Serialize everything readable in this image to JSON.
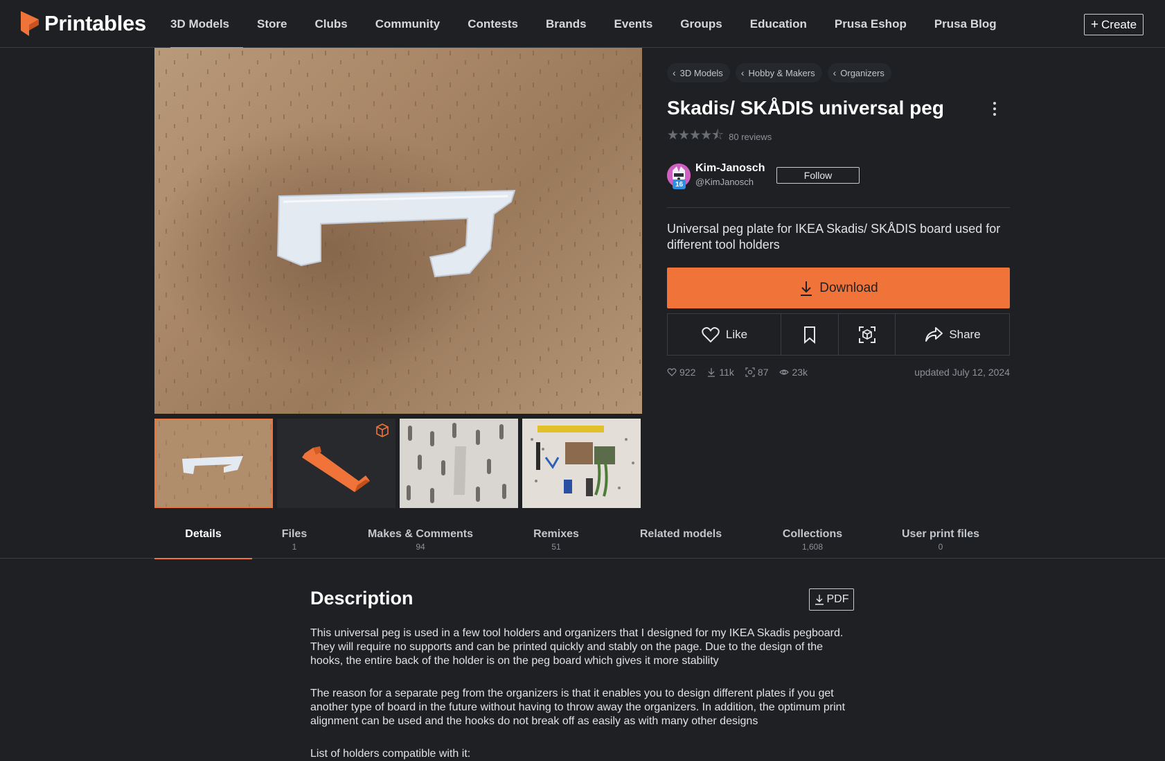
{
  "app": {
    "brand": "Printables",
    "accent": "#f0743a"
  },
  "nav": {
    "items": [
      "3D Models",
      "Store",
      "Clubs",
      "Community",
      "Contests",
      "Brands",
      "Events",
      "Groups",
      "Education",
      "Prusa Eshop",
      "Prusa Blog"
    ],
    "create_label": "Create"
  },
  "breadcrumbs": [
    "3D Models",
    "Hobby & Makers",
    "Organizers"
  ],
  "model": {
    "title": "Skadis/ SKÅDIS universal peg",
    "rating_stars": 4.5,
    "reviews": "80 reviews",
    "summary": "Universal peg plate for IKEA Skadis/ SKÅDIS board used for different tool holders"
  },
  "author": {
    "name": "Kim-Janosch",
    "handle": "@KimJanosch",
    "badge": "16",
    "follow_label": "Follow"
  },
  "actions": {
    "download": "Download",
    "like": "Like",
    "share": "Share",
    "icons": [
      "heart-icon",
      "bookmark-icon",
      "ar-view-icon",
      "share-icon"
    ]
  },
  "stats": {
    "likes": "922",
    "downloads": "11k",
    "makes": "87",
    "views": "23k",
    "updated": "updated July 12, 2024"
  },
  "tabs": [
    {
      "label": "Details",
      "count": ""
    },
    {
      "label": "Files",
      "count": "1"
    },
    {
      "label": "Makes & Comments",
      "count": "94"
    },
    {
      "label": "Remixes",
      "count": "51"
    },
    {
      "label": "Related models",
      "count": ""
    },
    {
      "label": "Collections",
      "count": "1,608"
    },
    {
      "label": "User print files",
      "count": "0"
    }
  ],
  "description": {
    "title": "Description",
    "pdf_label": "PDF",
    "p1": "This universal peg is used in a few tool holders and organizers that I designed for my IKEA Skadis pegboard. They will require no supports and can be printed quickly and stably on the page. Due to the design of the hooks, the entire back of the holder is on the peg board which gives it more stability",
    "p2": "The reason for a separate peg from the organizers is that it enables you to design different plates if you get another type of board in the future without having to throw away the organizers. In addition, the optimum print alignment can be used and the hooks do not break off as easily as with many other designs",
    "p3": "List of holders compatible with it:"
  }
}
